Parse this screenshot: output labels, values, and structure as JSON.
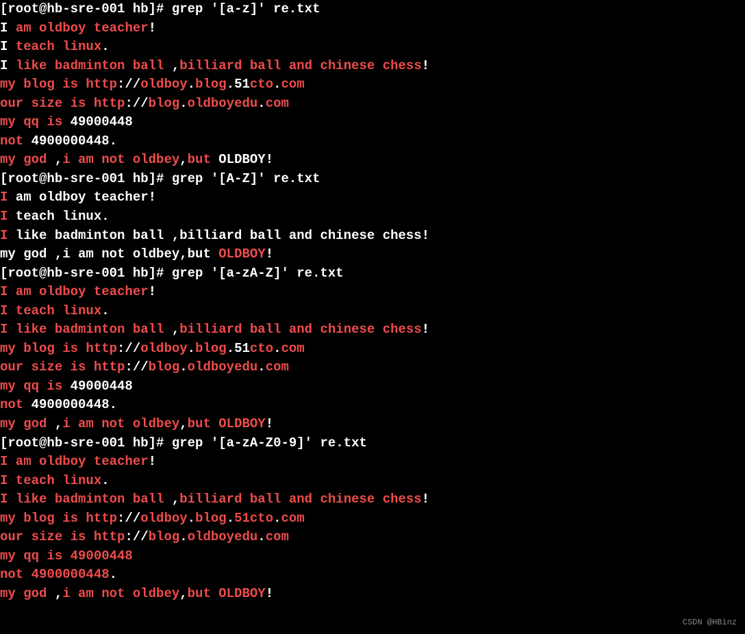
{
  "prompt": "[root@hb-sre-001 hb]# ",
  "commands": {
    "cmd1": "grep '[a-z]' re.txt",
    "cmd2": "grep '[A-Z]' re.txt",
    "cmd3": "grep '[a-zA-Z]' re.txt",
    "cmd4": "grep '[a-zA-Z0-9]' re.txt"
  },
  "lines": [
    {
      "segments": [
        {
          "t": "[root@hb-sre-001 hb]# grep '[a-z]' re.txt",
          "c": "w"
        }
      ]
    },
    {
      "segments": [
        {
          "t": "I ",
          "c": "w"
        },
        {
          "t": "am oldboy teacher",
          "c": "r"
        },
        {
          "t": "!",
          "c": "w"
        }
      ]
    },
    {
      "segments": [
        {
          "t": "I ",
          "c": "w"
        },
        {
          "t": "teach linux",
          "c": "r"
        },
        {
          "t": ".",
          "c": "w"
        }
      ]
    },
    {
      "segments": [
        {
          "t": "I ",
          "c": "w"
        },
        {
          "t": "like badminton ball ",
          "c": "r"
        },
        {
          "t": ",",
          "c": "w"
        },
        {
          "t": "billiard ball and chinese chess",
          "c": "r"
        },
        {
          "t": "!",
          "c": "w"
        }
      ]
    },
    {
      "segments": [
        {
          "t": "my blog is http",
          "c": "r"
        },
        {
          "t": "://",
          "c": "w"
        },
        {
          "t": "oldboy",
          "c": "r"
        },
        {
          "t": ".",
          "c": "w"
        },
        {
          "t": "blog",
          "c": "r"
        },
        {
          "t": ".51",
          "c": "w"
        },
        {
          "t": "cto",
          "c": "r"
        },
        {
          "t": ".",
          "c": "w"
        },
        {
          "t": "com",
          "c": "r"
        }
      ]
    },
    {
      "segments": [
        {
          "t": "our size is http",
          "c": "r"
        },
        {
          "t": "://",
          "c": "w"
        },
        {
          "t": "blog",
          "c": "r"
        },
        {
          "t": ".",
          "c": "w"
        },
        {
          "t": "oldboyedu",
          "c": "r"
        },
        {
          "t": ".",
          "c": "w"
        },
        {
          "t": "com",
          "c": "r"
        }
      ]
    },
    {
      "segments": [
        {
          "t": "my qq is",
          "c": "r"
        },
        {
          "t": " 49000448",
          "c": "w"
        }
      ]
    },
    {
      "segments": [
        {
          "t": "not",
          "c": "r"
        },
        {
          "t": " 4900000448.",
          "c": "w"
        }
      ]
    },
    {
      "segments": [
        {
          "t": "my god ",
          "c": "r"
        },
        {
          "t": ",",
          "c": "w"
        },
        {
          "t": "i am not oldbey",
          "c": "r"
        },
        {
          "t": ",",
          "c": "w"
        },
        {
          "t": "but",
          "c": "r"
        },
        {
          "t": " OLDBOY!",
          "c": "w"
        }
      ]
    },
    {
      "segments": [
        {
          "t": "[root@hb-sre-001 hb]# grep '[A-Z]' re.txt",
          "c": "w"
        }
      ]
    },
    {
      "segments": [
        {
          "t": "I",
          "c": "r"
        },
        {
          "t": " am oldboy teacher!",
          "c": "w"
        }
      ]
    },
    {
      "segments": [
        {
          "t": "I",
          "c": "r"
        },
        {
          "t": " teach linux.",
          "c": "w"
        }
      ]
    },
    {
      "segments": [
        {
          "t": "I",
          "c": "r"
        },
        {
          "t": " like badminton ball ,billiard ball and chinese chess!",
          "c": "w"
        }
      ]
    },
    {
      "segments": [
        {
          "t": "my god ,i am not oldbey,but ",
          "c": "w"
        },
        {
          "t": "OLDBOY",
          "c": "r"
        },
        {
          "t": "!",
          "c": "w"
        }
      ]
    },
    {
      "segments": [
        {
          "t": "[root@hb-sre-001 hb]# grep '[a-zA-Z]' re.txt",
          "c": "w"
        }
      ]
    },
    {
      "segments": [
        {
          "t": "I am oldboy teacher",
          "c": "r"
        },
        {
          "t": "!",
          "c": "w"
        }
      ]
    },
    {
      "segments": [
        {
          "t": "I teach linux",
          "c": "r"
        },
        {
          "t": ".",
          "c": "w"
        }
      ]
    },
    {
      "segments": [
        {
          "t": "I like badminton ball ",
          "c": "r"
        },
        {
          "t": ",",
          "c": "w"
        },
        {
          "t": "billiard ball and chinese chess",
          "c": "r"
        },
        {
          "t": "!",
          "c": "w"
        }
      ]
    },
    {
      "segments": [
        {
          "t": "my blog is http",
          "c": "r"
        },
        {
          "t": "://",
          "c": "w"
        },
        {
          "t": "oldboy",
          "c": "r"
        },
        {
          "t": ".",
          "c": "w"
        },
        {
          "t": "blog",
          "c": "r"
        },
        {
          "t": ".51",
          "c": "w"
        },
        {
          "t": "cto",
          "c": "r"
        },
        {
          "t": ".",
          "c": "w"
        },
        {
          "t": "com",
          "c": "r"
        }
      ]
    },
    {
      "segments": [
        {
          "t": "our size is http",
          "c": "r"
        },
        {
          "t": "://",
          "c": "w"
        },
        {
          "t": "blog",
          "c": "r"
        },
        {
          "t": ".",
          "c": "w"
        },
        {
          "t": "oldboyedu",
          "c": "r"
        },
        {
          "t": ".",
          "c": "w"
        },
        {
          "t": "com",
          "c": "r"
        }
      ]
    },
    {
      "segments": [
        {
          "t": "my qq is",
          "c": "r"
        },
        {
          "t": " 49000448",
          "c": "w"
        }
      ]
    },
    {
      "segments": [
        {
          "t": "not",
          "c": "r"
        },
        {
          "t": " 4900000448.",
          "c": "w"
        }
      ]
    },
    {
      "segments": [
        {
          "t": "my god ",
          "c": "r"
        },
        {
          "t": ",",
          "c": "w"
        },
        {
          "t": "i am not oldbey",
          "c": "r"
        },
        {
          "t": ",",
          "c": "w"
        },
        {
          "t": "but OLDBOY",
          "c": "r"
        },
        {
          "t": "!",
          "c": "w"
        }
      ]
    },
    {
      "segments": [
        {
          "t": "[root@hb-sre-001 hb]# grep '[a-zA-Z0-9]' re.txt",
          "c": "w"
        }
      ]
    },
    {
      "segments": [
        {
          "t": "I am oldboy teacher",
          "c": "r"
        },
        {
          "t": "!",
          "c": "w"
        }
      ]
    },
    {
      "segments": [
        {
          "t": "I teach linux",
          "c": "r"
        },
        {
          "t": ".",
          "c": "w"
        }
      ]
    },
    {
      "segments": [
        {
          "t": "I like badminton ball ",
          "c": "r"
        },
        {
          "t": ",",
          "c": "w"
        },
        {
          "t": "billiard ball and chinese chess",
          "c": "r"
        },
        {
          "t": "!",
          "c": "w"
        }
      ]
    },
    {
      "segments": [
        {
          "t": "my blog is http",
          "c": "r"
        },
        {
          "t": "://",
          "c": "w"
        },
        {
          "t": "oldboy",
          "c": "r"
        },
        {
          "t": ".",
          "c": "w"
        },
        {
          "t": "blog",
          "c": "r"
        },
        {
          "t": ".",
          "c": "w"
        },
        {
          "t": "51cto",
          "c": "r"
        },
        {
          "t": ".",
          "c": "w"
        },
        {
          "t": "com",
          "c": "r"
        }
      ]
    },
    {
      "segments": [
        {
          "t": "our size is http",
          "c": "r"
        },
        {
          "t": "://",
          "c": "w"
        },
        {
          "t": "blog",
          "c": "r"
        },
        {
          "t": ".",
          "c": "w"
        },
        {
          "t": "oldboyedu",
          "c": "r"
        },
        {
          "t": ".",
          "c": "w"
        },
        {
          "t": "com",
          "c": "r"
        }
      ]
    },
    {
      "segments": [
        {
          "t": "my qq is 49000448",
          "c": "r"
        }
      ]
    },
    {
      "segments": [
        {
          "t": "not 4900000448",
          "c": "r"
        },
        {
          "t": ".",
          "c": "w"
        }
      ]
    },
    {
      "segments": [
        {
          "t": "my god ",
          "c": "r"
        },
        {
          "t": ",",
          "c": "w"
        },
        {
          "t": "i am not oldbey",
          "c": "r"
        },
        {
          "t": ",",
          "c": "w"
        },
        {
          "t": "but OLDBOY",
          "c": "r"
        },
        {
          "t": "!",
          "c": "w"
        }
      ]
    }
  ],
  "watermark": "CSDN @HBinz"
}
